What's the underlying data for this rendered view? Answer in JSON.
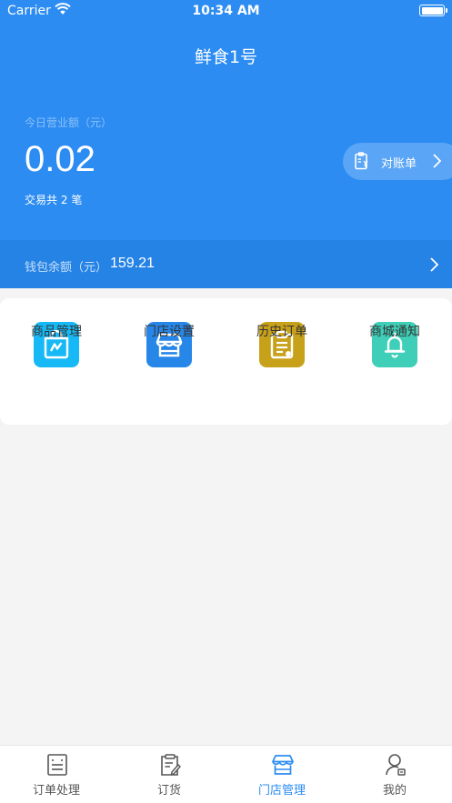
{
  "status_bar": {
    "carrier": "Carrier",
    "time": "10:34 AM"
  },
  "header": {
    "title": "鲜食1号"
  },
  "revenue": {
    "label": "今日营业额（元）",
    "amount": "0.02",
    "tx_prefix": "交易共",
    "tx_count": "2",
    "tx_suffix": "笔"
  },
  "reconcile_button": {
    "label": "对账单"
  },
  "wallet": {
    "label": "钱包余额（元）",
    "value": "159.21"
  },
  "menu": [
    {
      "label": "商品管理",
      "icon": "shopping-bag-icon",
      "color": "#16b9f5"
    },
    {
      "label": "门店设置",
      "icon": "storefront-icon",
      "color": "#2787e9"
    },
    {
      "label": "历史订单",
      "icon": "clipboard-icon",
      "color": "#c8a11a"
    },
    {
      "label": "商城通知",
      "icon": "bell-icon",
      "color": "#3fcfb8"
    }
  ],
  "tabbar": [
    {
      "label": "订单处理",
      "icon": "order-list-icon"
    },
    {
      "label": "订货",
      "icon": "clipboard-pen-icon"
    },
    {
      "label": "门店管理",
      "icon": "storefront-icon",
      "active": true
    },
    {
      "label": "我的",
      "icon": "profile-icon"
    }
  ],
  "colors": {
    "primary": "#2c8cf2",
    "wallet_bar": "#2683e6",
    "background": "#f4f4f4"
  }
}
